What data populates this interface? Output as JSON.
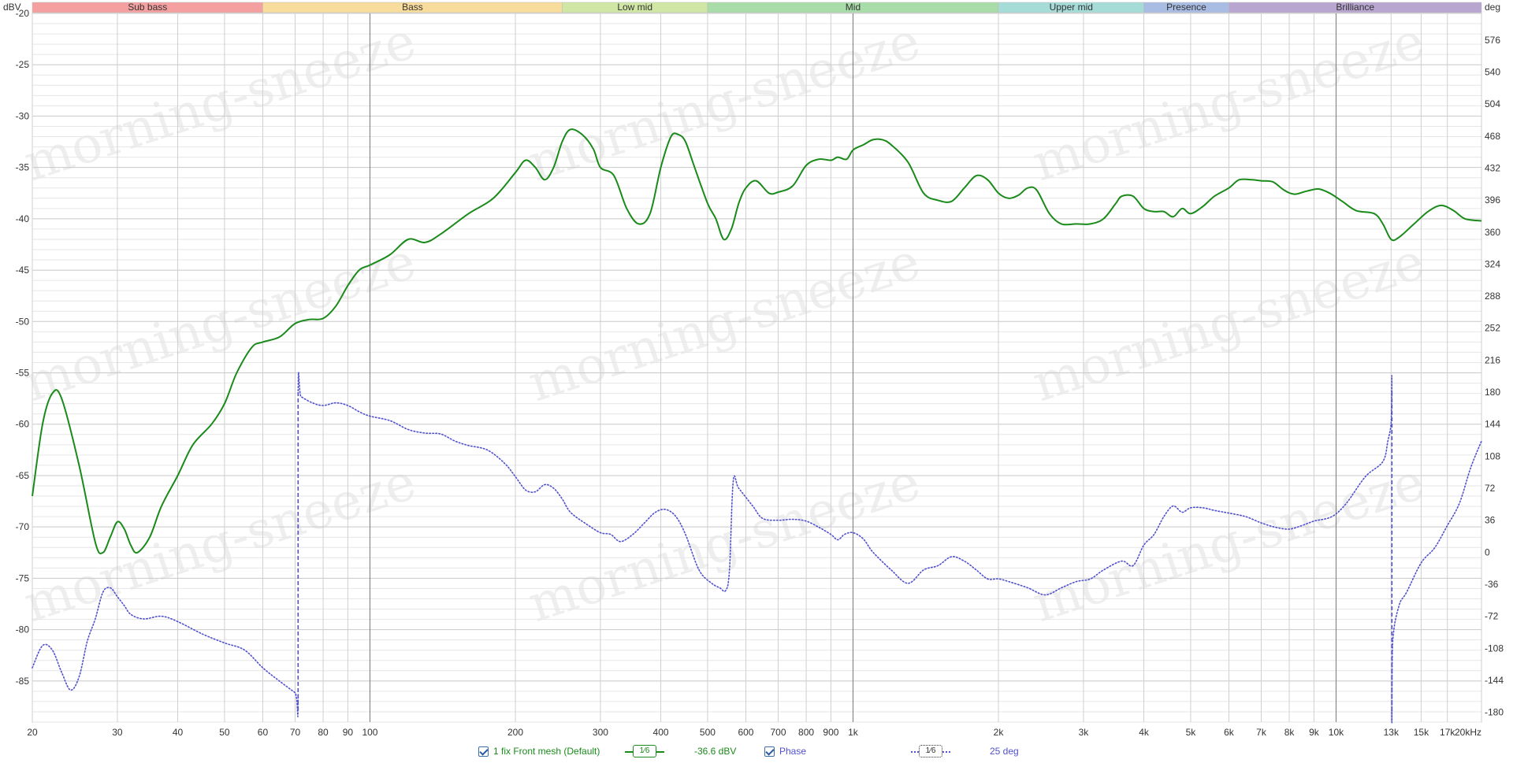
{
  "chart_data": {
    "type": "line",
    "x_scale": "log",
    "xlim": [
      20,
      20000
    ],
    "ylim": [
      -89,
      -20
    ],
    "y2lim": [
      -191,
      606
    ],
    "left_unit": "dBV",
    "right_unit": "deg",
    "x_ticks": [
      {
        "v": 20,
        "t": "20"
      },
      {
        "v": 30,
        "t": "30"
      },
      {
        "v": 40,
        "t": "40"
      },
      {
        "v": 50,
        "t": "50"
      },
      {
        "v": 60,
        "t": "60"
      },
      {
        "v": 70,
        "t": "70"
      },
      {
        "v": 80,
        "t": "80"
      },
      {
        "v": 90,
        "t": "90"
      },
      {
        "v": 100,
        "t": "100"
      },
      {
        "v": 200,
        "t": "200"
      },
      {
        "v": 300,
        "t": "300"
      },
      {
        "v": 400,
        "t": "400"
      },
      {
        "v": 500,
        "t": "500"
      },
      {
        "v": 600,
        "t": "600"
      },
      {
        "v": 700,
        "t": "700"
      },
      {
        "v": 800,
        "t": "800"
      },
      {
        "v": 900,
        "t": "900"
      },
      {
        "v": 1000,
        "t": "1k"
      },
      {
        "v": 2000,
        "t": "2k"
      },
      {
        "v": 3000,
        "t": "3k"
      },
      {
        "v": 4000,
        "t": "4k"
      },
      {
        "v": 5000,
        "t": "5k"
      },
      {
        "v": 6000,
        "t": "6k"
      },
      {
        "v": 7000,
        "t": "7k"
      },
      {
        "v": 8000,
        "t": "8k"
      },
      {
        "v": 9000,
        "t": "9k"
      },
      {
        "v": 10000,
        "t": "10k"
      },
      {
        "v": 13000,
        "t": "13k"
      },
      {
        "v": 15000,
        "t": "15k"
      },
      {
        "v": 17000,
        "t": "17k"
      },
      {
        "v": 20000,
        "t": "20kHz"
      }
    ],
    "y_ticks": [
      -20,
      -25,
      -30,
      -35,
      -40,
      -45,
      -50,
      -55,
      -60,
      -65,
      -70,
      -75,
      -80,
      -85
    ],
    "y2_ticks": [
      576,
      540,
      504,
      468,
      432,
      396,
      360,
      324,
      288,
      252,
      216,
      180,
      144,
      108,
      72,
      36,
      0,
      -36,
      -72,
      -108,
      -144,
      -180
    ],
    "bands": [
      {
        "name": "Sub bass",
        "from": 20,
        "to": 60,
        "color": "#f4a0a0"
      },
      {
        "name": "Bass",
        "from": 60,
        "to": 250,
        "color": "#f8dc9c"
      },
      {
        "name": "Low mid",
        "from": 250,
        "to": 500,
        "color": "#cfe6a4"
      },
      {
        "name": "Mid",
        "from": 500,
        "to": 2000,
        "color": "#a8dca8"
      },
      {
        "name": "Upper mid",
        "from": 2000,
        "to": 4000,
        "color": "#a6dcd8"
      },
      {
        "name": "Presence",
        "from": 4000,
        "to": 6000,
        "color": "#a9bde4"
      },
      {
        "name": "Brilliance",
        "from": 6000,
        "to": 20000,
        "color": "#b8a6d0"
      }
    ],
    "series": [
      {
        "name": "1 fix Front mesh (Default)",
        "axis": "left",
        "color": "#1a8a1a",
        "style": "solid",
        "points": [
          [
            20,
            -67
          ],
          [
            21,
            -60
          ],
          [
            22,
            -57
          ],
          [
            23,
            -57.5
          ],
          [
            25,
            -64
          ],
          [
            27,
            -71.5
          ],
          [
            28,
            -72.5
          ],
          [
            29,
            -71
          ],
          [
            30,
            -69.5
          ],
          [
            31,
            -70.2
          ],
          [
            32,
            -71.8
          ],
          [
            33,
            -72.5
          ],
          [
            35,
            -71
          ],
          [
            37,
            -68
          ],
          [
            40,
            -65
          ],
          [
            43,
            -62
          ],
          [
            47,
            -60
          ],
          [
            50,
            -58
          ],
          [
            53,
            -55
          ],
          [
            57,
            -52.5
          ],
          [
            60,
            -52
          ],
          [
            65,
            -51.5
          ],
          [
            70,
            -50.2
          ],
          [
            75,
            -49.8
          ],
          [
            80,
            -49.7
          ],
          [
            85,
            -48.5
          ],
          [
            90,
            -46.5
          ],
          [
            95,
            -45
          ],
          [
            100,
            -44.5
          ],
          [
            110,
            -43.5
          ],
          [
            120,
            -42
          ],
          [
            130,
            -42.3
          ],
          [
            140,
            -41.5
          ],
          [
            160,
            -39.5
          ],
          [
            180,
            -38
          ],
          [
            200,
            -35.5
          ],
          [
            210,
            -34.3
          ],
          [
            220,
            -35
          ],
          [
            230,
            -36.2
          ],
          [
            240,
            -35
          ],
          [
            250,
            -32.5
          ],
          [
            260,
            -31.3
          ],
          [
            275,
            -31.8
          ],
          [
            290,
            -33.2
          ],
          [
            300,
            -35
          ],
          [
            320,
            -35.8
          ],
          [
            340,
            -39
          ],
          [
            360,
            -40.5
          ],
          [
            380,
            -39.5
          ],
          [
            400,
            -35
          ],
          [
            420,
            -32
          ],
          [
            435,
            -31.8
          ],
          [
            450,
            -32.5
          ],
          [
            470,
            -35
          ],
          [
            500,
            -38.5
          ],
          [
            520,
            -40
          ],
          [
            540,
            -42
          ],
          [
            560,
            -41
          ],
          [
            580,
            -38.5
          ],
          [
            600,
            -37
          ],
          [
            630,
            -36.3
          ],
          [
            670,
            -37.5
          ],
          [
            700,
            -37.4
          ],
          [
            750,
            -36.8
          ],
          [
            800,
            -34.8
          ],
          [
            850,
            -34.2
          ],
          [
            900,
            -34.3
          ],
          [
            930,
            -34
          ],
          [
            970,
            -34.2
          ],
          [
            1000,
            -33.3
          ],
          [
            1050,
            -32.8
          ],
          [
            1100,
            -32.3
          ],
          [
            1150,
            -32.3
          ],
          [
            1200,
            -32.8
          ],
          [
            1300,
            -34.5
          ],
          [
            1400,
            -37.5
          ],
          [
            1500,
            -38.2
          ],
          [
            1600,
            -38.3
          ],
          [
            1700,
            -37
          ],
          [
            1800,
            -35.8
          ],
          [
            1900,
            -36.2
          ],
          [
            2000,
            -37.5
          ],
          [
            2100,
            -38
          ],
          [
            2200,
            -37.7
          ],
          [
            2300,
            -37
          ],
          [
            2400,
            -37.2
          ],
          [
            2550,
            -39.5
          ],
          [
            2700,
            -40.5
          ],
          [
            2900,
            -40.5
          ],
          [
            3100,
            -40.5
          ],
          [
            3300,
            -40
          ],
          [
            3500,
            -38.5
          ],
          [
            3600,
            -37.8
          ],
          [
            3800,
            -37.8
          ],
          [
            4000,
            -39
          ],
          [
            4200,
            -39.3
          ],
          [
            4400,
            -39.3
          ],
          [
            4600,
            -39.8
          ],
          [
            4800,
            -39
          ],
          [
            5000,
            -39.5
          ],
          [
            5300,
            -38.8
          ],
          [
            5600,
            -37.8
          ],
          [
            6000,
            -37
          ],
          [
            6300,
            -36.2
          ],
          [
            6700,
            -36.2
          ],
          [
            7000,
            -36.3
          ],
          [
            7400,
            -36.4
          ],
          [
            7800,
            -37.2
          ],
          [
            8200,
            -37.6
          ],
          [
            8700,
            -37.3
          ],
          [
            9200,
            -37.1
          ],
          [
            9700,
            -37.5
          ],
          [
            10300,
            -38.3
          ],
          [
            11000,
            -39.2
          ],
          [
            12000,
            -39.5
          ],
          [
            12500,
            -40.5
          ],
          [
            13000,
            -42
          ],
          [
            13500,
            -41.8
          ],
          [
            14500,
            -40.5
          ],
          [
            15500,
            -39.3
          ],
          [
            16500,
            -38.7
          ],
          [
            17500,
            -39.2
          ],
          [
            18500,
            -40
          ],
          [
            20000,
            -40.2
          ]
        ]
      },
      {
        "name": "Phase",
        "axis": "right",
        "color": "#5050d0",
        "style": "dotted",
        "points": [
          [
            20,
            -130
          ],
          [
            21,
            -105
          ],
          [
            22,
            -110
          ],
          [
            23,
            -135
          ],
          [
            24,
            -155
          ],
          [
            25,
            -140
          ],
          [
            26,
            -100
          ],
          [
            27,
            -75
          ],
          [
            28,
            -45
          ],
          [
            29,
            -40
          ],
          [
            30,
            -50
          ],
          [
            31,
            -60
          ],
          [
            32,
            -70
          ],
          [
            34,
            -75
          ],
          [
            37,
            -72
          ],
          [
            40,
            -78
          ],
          [
            45,
            -92
          ],
          [
            50,
            -102
          ],
          [
            55,
            -110
          ],
          [
            60,
            -130
          ],
          [
            65,
            -145
          ],
          [
            70,
            -158
          ],
          [
            71,
            -160
          ],
          [
            71.01,
            178
          ],
          [
            72,
            175
          ],
          [
            76,
            168
          ],
          [
            80,
            165
          ],
          [
            85,
            168
          ],
          [
            90,
            165
          ],
          [
            95,
            158
          ],
          [
            100,
            153
          ],
          [
            110,
            148
          ],
          [
            120,
            138
          ],
          [
            130,
            134
          ],
          [
            140,
            133
          ],
          [
            150,
            125
          ],
          [
            160,
            120
          ],
          [
            175,
            115
          ],
          [
            190,
            100
          ],
          [
            200,
            85
          ],
          [
            210,
            70
          ],
          [
            220,
            68
          ],
          [
            230,
            76
          ],
          [
            240,
            72
          ],
          [
            250,
            60
          ],
          [
            260,
            45
          ],
          [
            280,
            32
          ],
          [
            300,
            22
          ],
          [
            315,
            20
          ],
          [
            330,
            12
          ],
          [
            350,
            20
          ],
          [
            370,
            33
          ],
          [
            390,
            45
          ],
          [
            410,
            48
          ],
          [
            430,
            40
          ],
          [
            450,
            20
          ],
          [
            480,
            -20
          ],
          [
            510,
            -35
          ],
          [
            530,
            -40
          ],
          [
            545,
            -43
          ],
          [
            555,
            -20
          ],
          [
            565,
            80
          ],
          [
            580,
            72
          ],
          [
            620,
            52
          ],
          [
            650,
            38
          ],
          [
            700,
            36
          ],
          [
            750,
            37
          ],
          [
            800,
            35
          ],
          [
            850,
            28
          ],
          [
            900,
            20
          ],
          [
            930,
            14
          ],
          [
            960,
            20
          ],
          [
            1000,
            22
          ],
          [
            1050,
            15
          ],
          [
            1100,
            0
          ],
          [
            1200,
            -20
          ],
          [
            1300,
            -35
          ],
          [
            1400,
            -20
          ],
          [
            1500,
            -15
          ],
          [
            1600,
            -5
          ],
          [
            1700,
            -10
          ],
          [
            1800,
            -20
          ],
          [
            1900,
            -30
          ],
          [
            2000,
            -30
          ],
          [
            2100,
            -33
          ],
          [
            2300,
            -40
          ],
          [
            2500,
            -48
          ],
          [
            2700,
            -40
          ],
          [
            2900,
            -33
          ],
          [
            3100,
            -30
          ],
          [
            3300,
            -20
          ],
          [
            3600,
            -10
          ],
          [
            3800,
            -15
          ],
          [
            4000,
            8
          ],
          [
            4200,
            20
          ],
          [
            4400,
            40
          ],
          [
            4600,
            52
          ],
          [
            4800,
            45
          ],
          [
            5000,
            50
          ],
          [
            5300,
            50
          ],
          [
            5600,
            47
          ],
          [
            6000,
            44
          ],
          [
            6500,
            40
          ],
          [
            7000,
            33
          ],
          [
            7500,
            28
          ],
          [
            8000,
            26
          ],
          [
            8500,
            30
          ],
          [
            9000,
            35
          ],
          [
            9800,
            40
          ],
          [
            10500,
            55
          ],
          [
            11500,
            85
          ],
          [
            12500,
            102
          ],
          [
            12800,
            125
          ],
          [
            13000,
            145
          ],
          [
            13050,
            180
          ],
          [
            13050.01,
            -180
          ],
          [
            13100,
            -100
          ],
          [
            13500,
            -60
          ],
          [
            14000,
            -45
          ],
          [
            15000,
            -12
          ],
          [
            16000,
            5
          ],
          [
            17000,
            30
          ],
          [
            18000,
            55
          ],
          [
            19000,
            95
          ],
          [
            20000,
            125
          ]
        ],
        "markers": [
          {
            "x": 71,
            "from": -178,
            "to": 180
          },
          {
            "x": 13050,
            "from": -180,
            "to": 180
          }
        ]
      }
    ]
  },
  "legend": {
    "series1_label": "1 fix Front mesh (Default)",
    "series1_smoothing": "1⁄6",
    "series1_value": "-36.6 dBV",
    "series2_label": "Phase",
    "series2_smoothing": "1⁄6",
    "series2_value": "25 deg"
  },
  "watermark": "morning-sneeze",
  "colors": {
    "magnitude": "#1a8a1a",
    "phase": "#5050d0"
  }
}
